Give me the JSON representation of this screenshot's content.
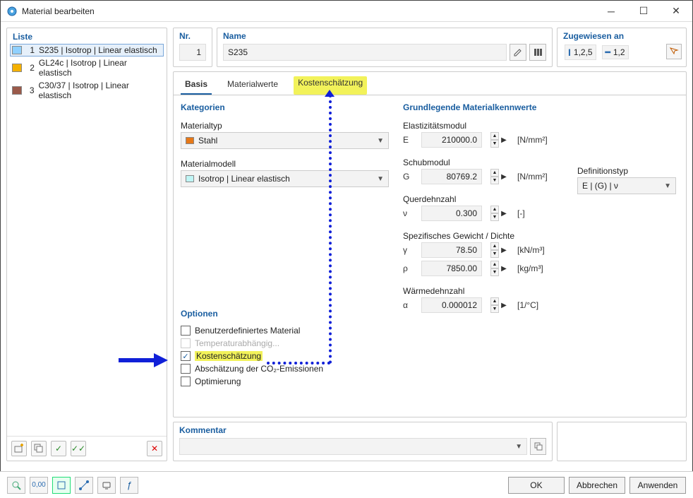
{
  "window": {
    "title": "Material bearbeiten"
  },
  "list": {
    "title": "Liste",
    "items": [
      {
        "no": "1",
        "name": "S235 | Isotrop | Linear elastisch",
        "color": "#8fd0ff",
        "selected": true
      },
      {
        "no": "2",
        "name": "GL24c | Isotrop | Linear elastisch",
        "color": "#f4b000",
        "selected": false
      },
      {
        "no": "3",
        "name": "C30/37 | Isotrop | Linear elastisch",
        "color": "#9a5a4a",
        "selected": false
      }
    ]
  },
  "header": {
    "nr_label": "Nr.",
    "nr_value": "1",
    "name_label": "Name",
    "name_value": "S235",
    "assigned_label": "Zugewiesen an",
    "assigned_items": [
      "1,2,5",
      "1,2"
    ]
  },
  "tabs": {
    "basis": "Basis",
    "werte": "Materialwerte",
    "kosten": "Kostenschätzung"
  },
  "form": {
    "cat_title": "Kategorien",
    "mattype_label": "Materialtyp",
    "mattype_value": "Stahl",
    "mattype_color": "#e67817",
    "model_label": "Materialmodell",
    "model_value": "Isotrop | Linear elastisch",
    "model_color": "#bff5f5",
    "opts_title": "Optionen",
    "opts": {
      "user": "Benutzerdefiniertes Material",
      "temp": "Temperaturabhängig...",
      "cost": "Kostenschätzung",
      "co2": "Abschätzung der CO₂-Emissionen",
      "opt": "Optimierung"
    }
  },
  "props": {
    "title": "Grundlegende Materialkennwerte",
    "emod_label": "Elastizitätsmodul",
    "e_sym": "E",
    "e_val": "210000.0",
    "e_unit": "[N/mm²]",
    "gmod_label": "Schubmodul",
    "g_sym": "G",
    "g_val": "80769.2",
    "g_unit": "[N/mm²]",
    "def_label": "Definitionstyp",
    "def_value": "E | (G) | ν",
    "poisson_label": "Querdehnzahl",
    "nu_sym": "ν",
    "nu_val": "0.300",
    "nu_unit": "[-]",
    "spec_label": "Spezifisches Gewicht / Dichte",
    "gamma_sym": "γ",
    "gamma_val": "78.50",
    "gamma_unit": "[kN/m³]",
    "rho_sym": "ρ",
    "rho_val": "7850.00",
    "rho_unit": "[kg/m³]",
    "therm_label": "Wärmedehnzahl",
    "alpha_sym": "α",
    "alpha_val": "0.000012",
    "alpha_unit": "[1/°C]"
  },
  "comment": {
    "label": "Kommentar"
  },
  "buttons": {
    "ok": "OK",
    "cancel": "Abbrechen",
    "apply": "Anwenden"
  }
}
